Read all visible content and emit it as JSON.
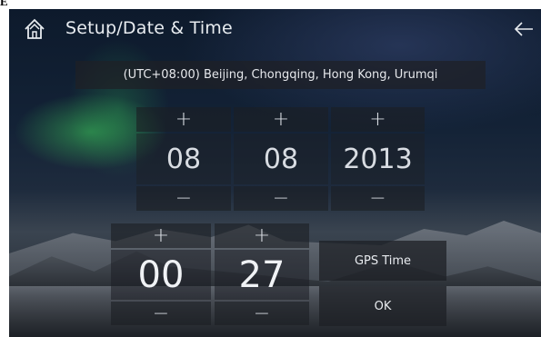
{
  "window": {
    "corner_glyph": "E"
  },
  "header": {
    "title": "Setup/Date & Time",
    "home_icon": "home-icon",
    "back_icon": "arrow-left-icon"
  },
  "timezone": {
    "label": "(UTC+08:00) Beijing, Chongqing, Hong Kong, Urumqi"
  },
  "date": {
    "plus_symbol": "+",
    "minus_symbol": "−",
    "day": "08",
    "month": "08",
    "year": "2013"
  },
  "time": {
    "plus_symbol": "+",
    "minus_symbol": "−",
    "hour": "00",
    "minute": "27"
  },
  "actions": {
    "gps_time": "GPS Time",
    "ok": "OK"
  },
  "colors": {
    "panel": "#1c1e24",
    "text": "#d8dce2",
    "aurora": "#3cc85a"
  }
}
